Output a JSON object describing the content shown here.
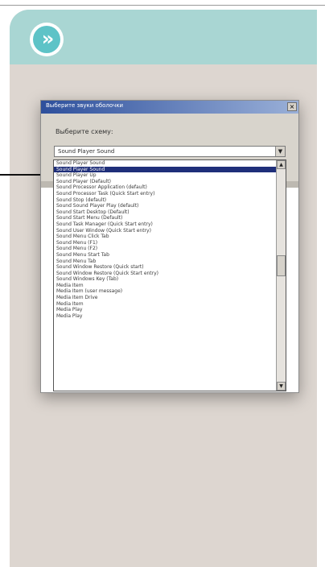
{
  "panel": {
    "badge_glyph": "»",
    "header_color": "#a9d6d3",
    "background_color": "#ddd6d0",
    "accent_color": "#5ec3c7"
  },
  "dialog": {
    "title": "Выберите звуки оболочки",
    "close_glyph": "×",
    "label": "Выберите схему:",
    "combo_value": "Sound Player Sound",
    "combo_arrow": "▼"
  },
  "dropdown": {
    "items": [
      "Sound Player Sound",
      "Sound Player Sound",
      "Sound Player Up",
      "Sound Player (Default)",
      "Sound Processor Application (default)",
      "Sound Processor Task (Quick Start entry)",
      "Sound Stop (default)",
      "Sound Sound Player Play (default)",
      "Sound Start Desktop (Default)",
      "Sound Start Menu (Default)",
      "Sound Task Manager (Quick Start entry)",
      "Sound User Window (Quick Start entry)",
      "Sound Menu Click Tab",
      "Sound Menu (F1)",
      "Sound Menu (F2)",
      "Sound Menu Start Tab",
      "Sound Menu Tab",
      "Sound Window Restore (Quick start)",
      "Sound Window Restore (Quick Start entry)",
      "Sound Windows Key (Tab)",
      "Media Item",
      "Media Item (user message)",
      "Media Item Drive",
      "Media Item",
      "Media Play",
      "Media Play"
    ],
    "selected_index": 1,
    "scroll_up_glyph": "▲",
    "scroll_down_glyph": "▼",
    "selection_color": "#1f2f7a"
  }
}
